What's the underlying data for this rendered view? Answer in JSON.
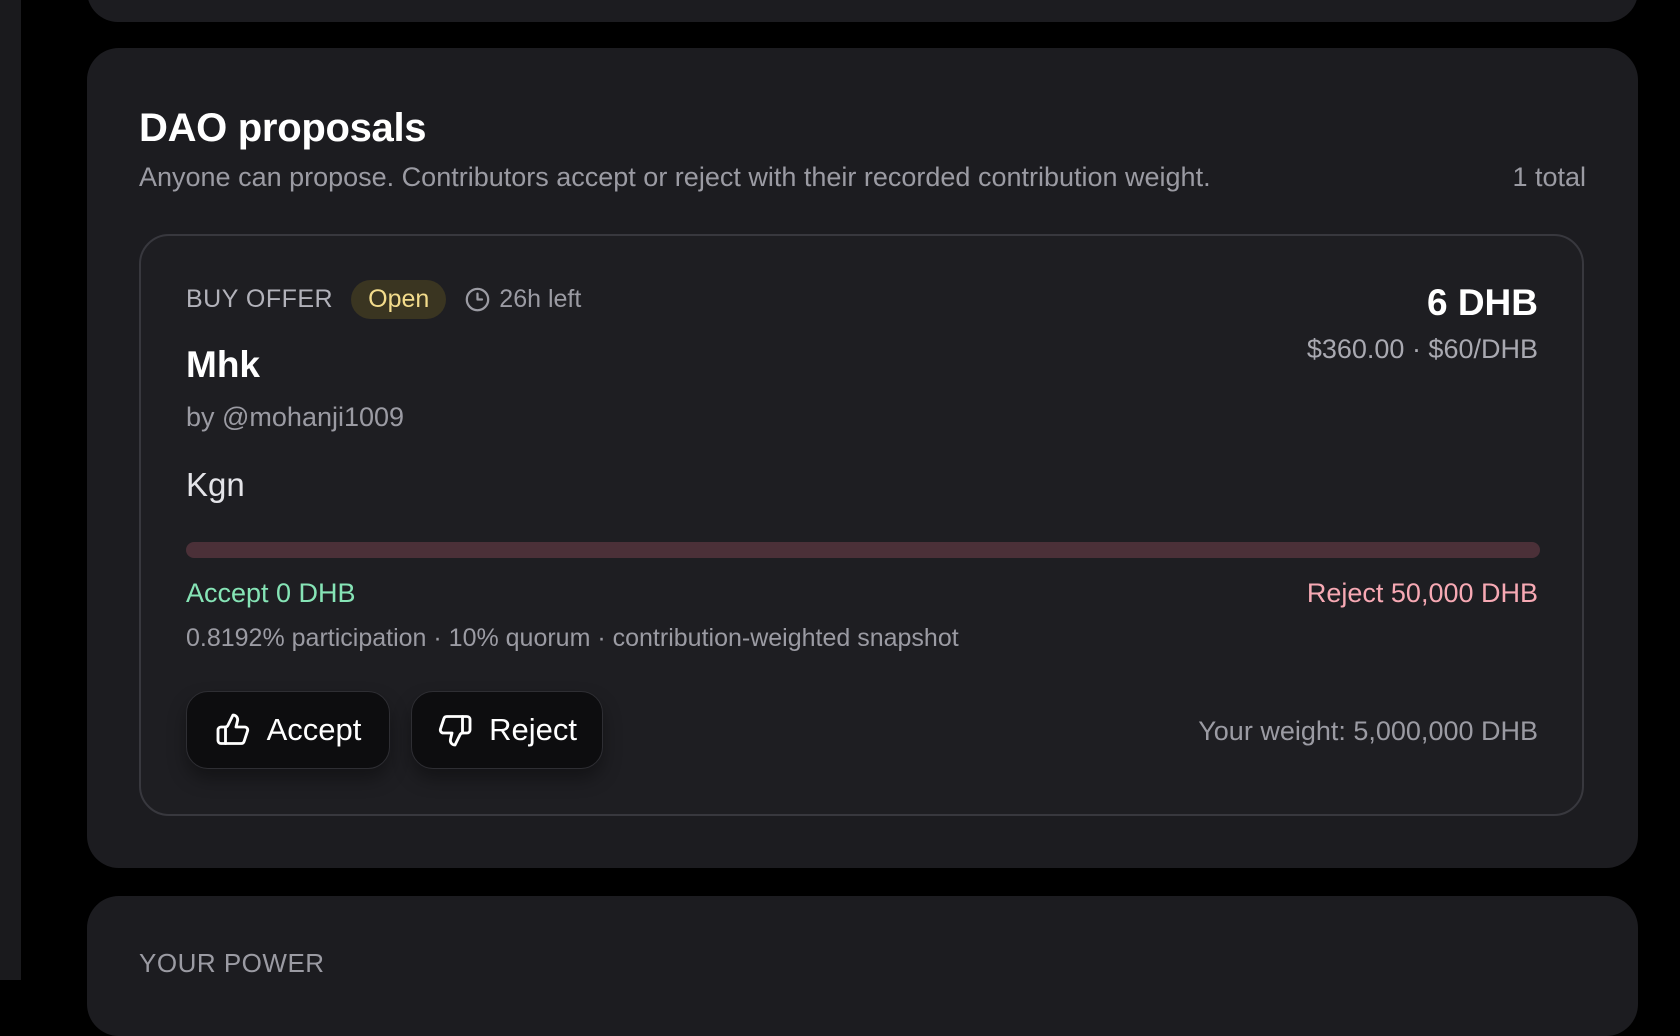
{
  "dao": {
    "title": "DAO proposals",
    "subtitle": "Anyone can propose. Contributors accept or reject with their recorded contribution weight.",
    "total": "1 total"
  },
  "proposal": {
    "type": "BUY OFFER",
    "status": "Open",
    "time_left": "26h left",
    "title": "Mhk",
    "author": "by @mohanji1009",
    "description": "Kgn",
    "amount": "6 DHB",
    "price": "$360.00 · $60/DHB",
    "accept_total": "Accept 0 DHB",
    "reject_total": "Reject 50,000 DHB",
    "accept_fraction": 0,
    "participation": "0.8192% participation · 10% quorum · contribution-weighted snapshot",
    "accept_button": "Accept",
    "reject_button": "Reject",
    "your_weight": "Your weight: 5,000,000 DHB"
  },
  "power": {
    "label": "YOUR POWER"
  },
  "colors": {
    "accept": "#86e4b6",
    "reject": "#f7a9b4",
    "status_open_bg": "#3a3521",
    "status_open_text": "#f3dc8c",
    "vote_bar_bg": "#4b3038"
  },
  "icons": {
    "time": "clock-icon",
    "accept": "thumbs-up-icon",
    "reject": "thumbs-down-icon"
  }
}
